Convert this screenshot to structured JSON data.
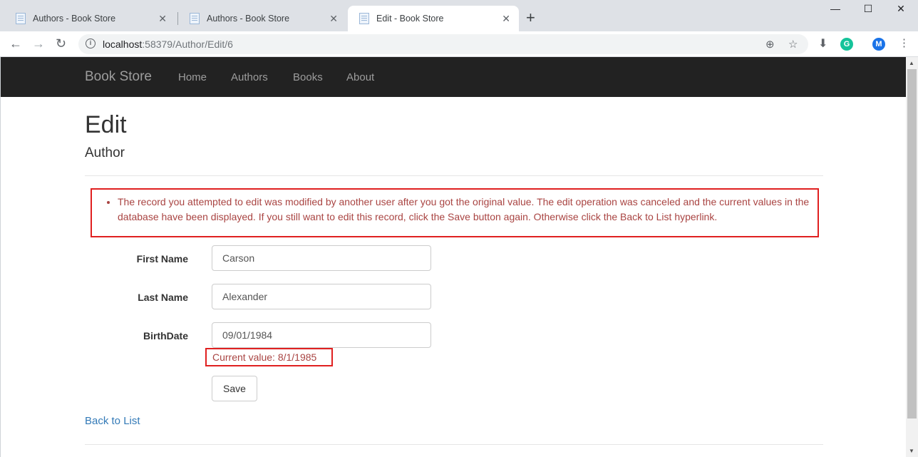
{
  "browser": {
    "tabs": [
      {
        "label": "Authors - Book Store",
        "active": false
      },
      {
        "label": "Authors - Book Store",
        "active": false
      },
      {
        "label": "Edit - Book Store",
        "active": true
      }
    ],
    "url_host": "localhost",
    "url_rest": ":58379/Author/Edit/6",
    "profile_initial": "M",
    "grammarly_initial": "G"
  },
  "navbar": {
    "brand": "Book Store",
    "links": [
      "Home",
      "Authors",
      "Books",
      "About"
    ]
  },
  "page": {
    "title": "Edit",
    "subtitle": "Author",
    "error_message": "The record you attempted to edit was modified by another user after you got the original value. The edit operation was canceled and the current values in the database have been displayed. If you still want to edit this record, click the Save button again. Otherwise click the Back to List hyperlink.",
    "form": {
      "first_name_label": "First Name",
      "first_name_value": "Carson",
      "last_name_label": "Last Name",
      "last_name_value": "Alexander",
      "birthdate_label": "BirthDate",
      "birthdate_value": "09/01/1984",
      "current_value_note": "Current value: 8/1/1985",
      "save_label": "Save"
    },
    "back_link": "Back to List"
  },
  "colors": {
    "navbar_bg": "#222222",
    "error_text": "#a94442",
    "highlight_border": "#e02020",
    "link": "#337ab7"
  }
}
